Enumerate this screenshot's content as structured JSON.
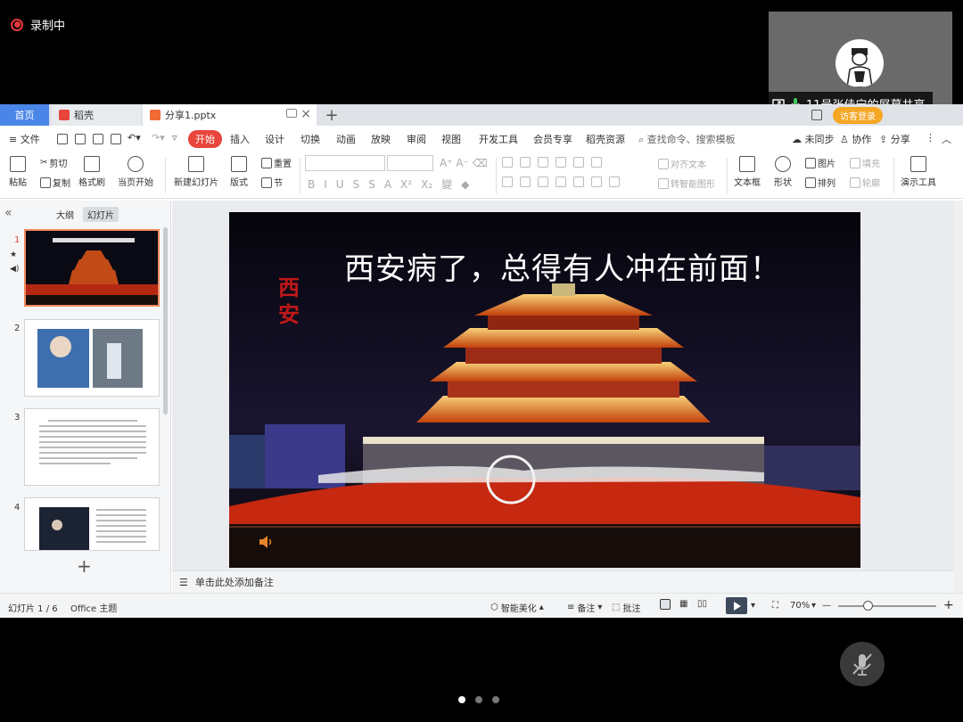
{
  "recording": {
    "label": "录制中"
  },
  "video_tile": {
    "share_label": "11号张佳宁的屏幕共享"
  },
  "tabs": {
    "home": "首页",
    "daoke": "稻壳",
    "file": "分享1.pptx",
    "login": "访客登录"
  },
  "menu": {
    "file": "文件",
    "items": [
      "开始",
      "插入",
      "设计",
      "切换",
      "动画",
      "放映",
      "审阅",
      "视图",
      "开发工具",
      "会员专享",
      "稻壳资源"
    ],
    "active": "开始",
    "search": "查找命令、搜索模板",
    "unsynced": "未同步",
    "collab": "协作",
    "share": "分享"
  },
  "ribbon": {
    "paste": "粘贴",
    "cut": "剪切",
    "copy": "复制",
    "format_painter": "格式刷",
    "from_current": "当页开始",
    "new_slide": "新建幻灯片",
    "layout": "版式",
    "reset": "重置",
    "section": "节",
    "align_text": "对齐文本",
    "smart_graphic": "转智能图形",
    "textbox": "文本框",
    "shape": "形状",
    "picture": "图片",
    "fill": "填充",
    "arrange": "排列",
    "outline": "轮廓",
    "present_tools": "演示工具"
  },
  "left_pane": {
    "tab_outline": "大纲",
    "tab_slides": "幻灯片",
    "slide_numbers": [
      "1",
      "2",
      "3",
      "4"
    ]
  },
  "slide": {
    "title": "西安病了，总得有人冲在前面！",
    "seal_text": "西安"
  },
  "notes": {
    "placeholder": "单击此处添加备注"
  },
  "status": {
    "slide_counter": "幻灯片 1 / 6",
    "theme": "Office 主题",
    "beautify": "智能美化",
    "notes": "备注",
    "comment": "批注",
    "zoom": "70%",
    "zoom_level": 0.3
  },
  "colors": {
    "accent": "#e8453c",
    "home_tab": "#4a86e8",
    "record": "#e5393b"
  }
}
